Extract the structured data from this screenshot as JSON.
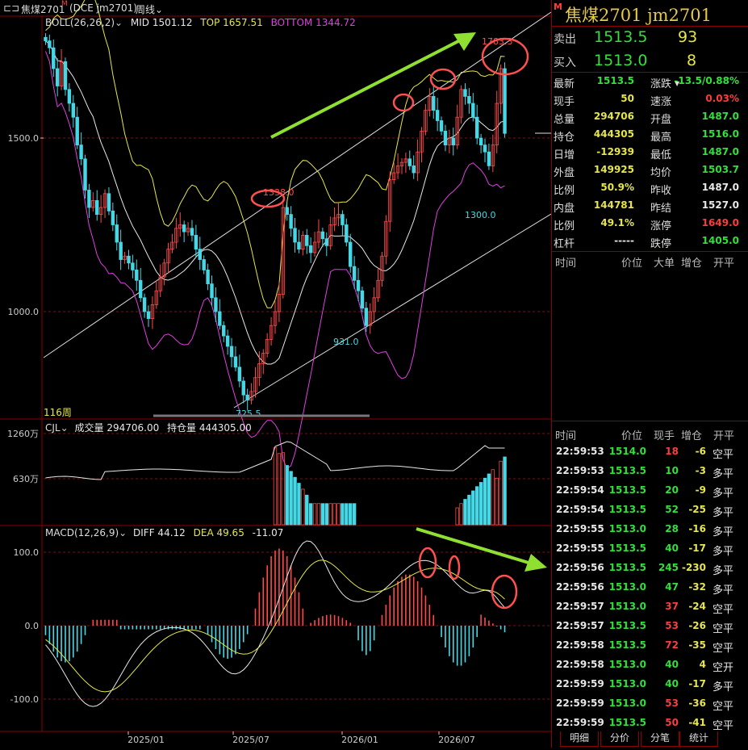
{
  "header": {
    "window_icon": "menu-icon",
    "title": "焦煤2701",
    "marker": "M",
    "code": "(DCE jm2701)",
    "period": "周线"
  },
  "panels": {
    "price": {
      "indicator": "BOLL(26,26,2)",
      "mid": "MID 1501.12",
      "top": "TOP 1657.51",
      "bottom": "BOTTOM 1344.72",
      "y_ticks": [
        "1500.0",
        "1000.0"
      ],
      "period_count": "116周",
      "annotations": [
        "1783.3",
        "1338.0",
        "1300.0",
        "931.0",
        "725.5"
      ]
    },
    "volume": {
      "indicator": "CJL",
      "volume_text": "成交量 294706.00",
      "oi_text": "持仓量 444305.00",
      "y_ticks": [
        "1260万",
        "630万"
      ]
    },
    "macd": {
      "indicator": "MACD(12,26,9)",
      "diff": "DIFF 44.12",
      "dea": "DEA 49.65",
      "macd": "-11.07",
      "y_ticks": [
        "100.0",
        "0.0",
        "-100.0"
      ]
    },
    "x_ticks": [
      "2025/01",
      "2025/07",
      "2026/01",
      "2026/07"
    ]
  },
  "chart_data": {
    "type": "candlestick",
    "weeks": 116,
    "close": [
      1780,
      1760,
      1700,
      1650,
      1720,
      1640,
      1600,
      1560,
      1480,
      1440,
      1350,
      1300,
      1320,
      1280,
      1300,
      1340,
      1290,
      1250,
      1200,
      1150,
      1160,
      1140,
      1120,
      1090,
      1040,
      1000,
      980,
      1020,
      1060,
      1100,
      1140,
      1180,
      1200,
      1240,
      1250,
      1230,
      1240,
      1220,
      1180,
      1150,
      1120,
      1080,
      1040,
      1000,
      960,
      930,
      900,
      870,
      840,
      800,
      760,
      745,
      770,
      810,
      850,
      880,
      920,
      960,
      1000,
      1050,
      1300,
      1280,
      1240,
      1200,
      1180,
      1220,
      1190,
      1170,
      1200,
      1230,
      1210,
      1190,
      1250,
      1270,
      1280,
      1250,
      1200,
      1130,
      1090,
      1060,
      1010,
      960,
      1000,
      1040,
      1090,
      1160,
      1260,
      1380,
      1400,
      1420,
      1430,
      1440,
      1420,
      1400,
      1460,
      1520,
      1580,
      1620,
      1580,
      1550,
      1520,
      1480,
      1500,
      1480,
      1560,
      1640,
      1620,
      1600,
      1560,
      1500,
      1480,
      1460,
      1420,
      1480,
      1600,
      1700,
      1513.5
    ],
    "annotations": {
      "high": 1783.3,
      "low": 725.5,
      "marks": [
        1338.0,
        1300.0,
        931.0
      ]
    },
    "ylim": [
      690,
      1860
    ],
    "macd": {
      "diff": 44.12,
      "dea": 49.65,
      "hist": -11.07
    },
    "volume": {
      "cjl": 294706.0,
      "oi": 444305.0
    }
  },
  "quote": {
    "title": "焦煤2701  jm2701",
    "marker": "M",
    "ask": {
      "label": "卖出",
      "price": "1513.5",
      "qty": "93"
    },
    "bid": {
      "label": "买入",
      "price": "1513.0",
      "qty": "8"
    },
    "left": [
      {
        "label": "最新",
        "value": "1513.5",
        "color": "g"
      },
      {
        "label": "现手",
        "value": "50",
        "color": "y"
      },
      {
        "label": "总量",
        "value": "294706",
        "color": "y"
      },
      {
        "label": "持仓",
        "value": "444305",
        "color": "y"
      },
      {
        "label": "日增",
        "value": "-12939",
        "color": "y"
      },
      {
        "label": "外盘",
        "value": "149925",
        "color": "y"
      },
      {
        "label": "比例",
        "value": "50.9%",
        "color": "y"
      },
      {
        "label": "内盘",
        "value": "144781",
        "color": "y"
      },
      {
        "label": "比例",
        "value": "49.1%",
        "color": "y"
      },
      {
        "label": "杠杆",
        "value": "-----",
        "color": "w"
      }
    ],
    "right": [
      {
        "label": "涨跌",
        "value": "-13.5/0.88%",
        "color": "g"
      },
      {
        "label": "速涨",
        "value": "0.03%",
        "color": "r"
      },
      {
        "label": "开盘",
        "value": "1487.0",
        "color": "g"
      },
      {
        "label": "最高",
        "value": "1516.0",
        "color": "g"
      },
      {
        "label": "最低",
        "value": "1487.0",
        "color": "g"
      },
      {
        "label": "均价",
        "value": "1503.7",
        "color": "g"
      },
      {
        "label": "昨收",
        "value": "1487.0",
        "color": "w"
      },
      {
        "label": "昨结",
        "value": "1527.0",
        "color": "w"
      },
      {
        "label": "涨停",
        "value": "1649.0",
        "color": "r"
      },
      {
        "label": "跌停",
        "value": "1405.0",
        "color": "g"
      }
    ],
    "big_headers": [
      "时间",
      "价位",
      "大单",
      "增仓",
      "开平"
    ],
    "tick_headers": [
      "时间",
      "价位",
      "现手",
      "增仓",
      "开平"
    ],
    "ticks": [
      {
        "time": "22:59:53",
        "price": "1514.0",
        "vol": "18",
        "chg": "-6",
        "type": "空平",
        "pc": "g",
        "vc": "r"
      },
      {
        "time": "22:59:53",
        "price": "1513.5",
        "vol": "10",
        "chg": "-3",
        "type": "多平",
        "pc": "g",
        "vc": "g"
      },
      {
        "time": "22:59:54",
        "price": "1513.5",
        "vol": "20",
        "chg": "-9",
        "type": "多平",
        "pc": "g",
        "vc": "g"
      },
      {
        "time": "22:59:54",
        "price": "1513.5",
        "vol": "52",
        "chg": "-25",
        "type": "多平",
        "pc": "g",
        "vc": "g"
      },
      {
        "time": "22:59:55",
        "price": "1513.0",
        "vol": "28",
        "chg": "-16",
        "type": "多平",
        "pc": "g",
        "vc": "g"
      },
      {
        "time": "22:59:55",
        "price": "1513.5",
        "vol": "40",
        "chg": "-17",
        "type": "多平",
        "pc": "g",
        "vc": "g"
      },
      {
        "time": "22:59:56",
        "price": "1513.5",
        "vol": "245",
        "chg": "-230",
        "type": "多平",
        "pc": "g",
        "vc": "g"
      },
      {
        "time": "22:59:56",
        "price": "1513.0",
        "vol": "47",
        "chg": "-32",
        "type": "多平",
        "pc": "g",
        "vc": "g"
      },
      {
        "time": "22:59:57",
        "price": "1513.0",
        "vol": "37",
        "chg": "-24",
        "type": "空平",
        "pc": "g",
        "vc": "r"
      },
      {
        "time": "22:59:57",
        "price": "1513.5",
        "vol": "53",
        "chg": "-26",
        "type": "空平",
        "pc": "g",
        "vc": "r"
      },
      {
        "time": "22:59:58",
        "price": "1513.5",
        "vol": "72",
        "chg": "-35",
        "type": "空平",
        "pc": "g",
        "vc": "r"
      },
      {
        "time": "22:59:58",
        "price": "1513.0",
        "vol": "40",
        "chg": "4",
        "type": "空开",
        "pc": "g",
        "vc": "g"
      },
      {
        "time": "22:59:59",
        "price": "1513.0",
        "vol": "40",
        "chg": "-17",
        "type": "多平",
        "pc": "g",
        "vc": "g"
      },
      {
        "time": "22:59:59",
        "price": "1513.0",
        "vol": "53",
        "chg": "-36",
        "type": "空平",
        "pc": "g",
        "vc": "r"
      },
      {
        "time": "22:59:59",
        "price": "1513.5",
        "vol": "50",
        "chg": "-41",
        "type": "空平",
        "pc": "g",
        "vc": "r"
      }
    ],
    "tabs": [
      "明细",
      "分价",
      "分笔",
      "统计"
    ]
  }
}
